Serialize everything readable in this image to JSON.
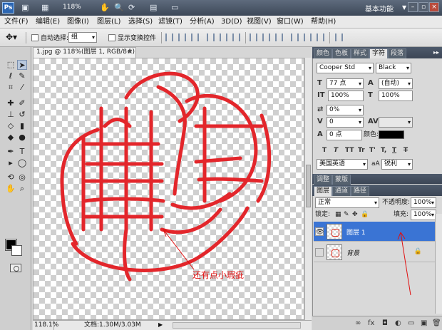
{
  "app": {
    "logo": "Ps",
    "zoom": "118%",
    "workspace": "基本功能",
    "icons": [
      "mini-bridge-icon",
      "view-extras-icon",
      "hand-icon",
      "zoom-icon",
      "rotate-view-icon",
      "arrange-documents-icon",
      "screen-mode-icon"
    ],
    "window_buttons": [
      "–",
      "▫",
      "×"
    ]
  },
  "menu": [
    "文件(F)",
    "编辑(E)",
    "图像(I)",
    "图层(L)",
    "选择(S)",
    "滤镜(T)",
    "分析(A)",
    "3D(D)",
    "视图(V)",
    "窗口(W)",
    "帮助(H)"
  ],
  "options": {
    "auto_select_label": "自动选择:",
    "auto_select_value": "组",
    "show_transform_label": "显示变换控件"
  },
  "document": {
    "tab_title": "1.jpg @ 118%(图层 1, RGB/8#) *",
    "close": "×",
    "status_zoom": "118.1%",
    "status_doc": "文档:1.30M/3.03M",
    "status_arrow": "▶",
    "annotation": "还有点小瑕疵"
  },
  "char_panel": {
    "tabs": [
      "颜色",
      "色板",
      "样式",
      "字符",
      "段落"
    ],
    "active_tab": "字符",
    "font_family": "Cooper Std",
    "font_style": "Black",
    "font_size": "77 点",
    "leading": "(自动)",
    "vert_scale": "100%",
    "horiz_scale": "100%",
    "tracking": "0%",
    "kerning": "0",
    "baseline": "0 点",
    "color_label": "颜色:",
    "text_color": "#000000",
    "format_buttons": [
      "T",
      "T",
      "TT",
      "Tr",
      "T'",
      "T,",
      "T",
      "T"
    ],
    "language": "美国英语",
    "aa_icon": "aA",
    "antialias": "锐利"
  },
  "adjust_tabs": [
    "调整",
    "蒙版"
  ],
  "layers": {
    "tabs": [
      "图层",
      "通道",
      "路径"
    ],
    "blend_mode": "正常",
    "opacity_label": "不透明度:",
    "opacity": "100%",
    "lock_label": "锁定:",
    "fill_label": "填充:",
    "fill": "100%",
    "rows": [
      {
        "name": "图层 1",
        "selected": true
      },
      {
        "name": "背景",
        "selected": false
      }
    ],
    "footer_icons": [
      "∞",
      "fx",
      "◘",
      "◐",
      "▭",
      "▣",
      "🗑"
    ]
  },
  "colors": {
    "seal_red": "#e3262b",
    "annotation_red": "#e01010",
    "selection_blue": "#3a74d4"
  }
}
